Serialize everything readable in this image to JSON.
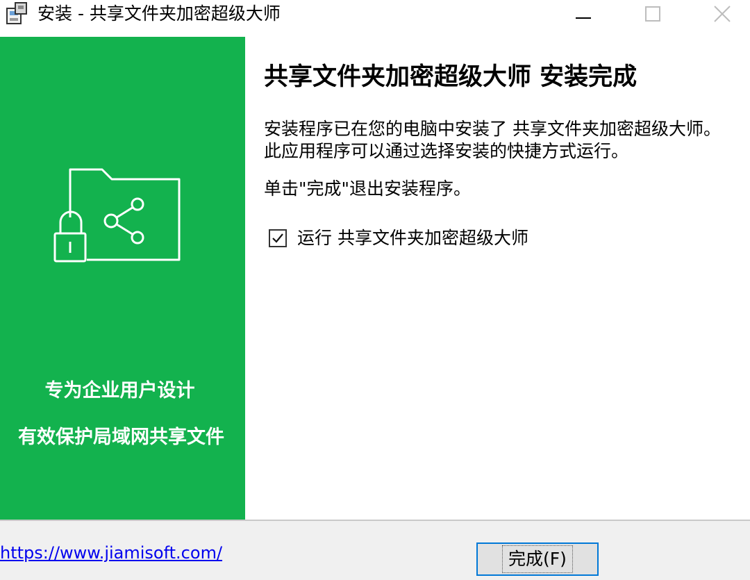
{
  "window": {
    "title": "安装 - 共享文件夹加密超级大师",
    "controls": {
      "minimize": "minimize-icon",
      "maximize": "maximize-icon",
      "close": "close-icon"
    }
  },
  "side_panel": {
    "background": "#13b24e",
    "icon": "folder-lock-share-icon",
    "line1": "专为企业用户设计",
    "line2": "有效保护局域网共享文件"
  },
  "content": {
    "title": "共享文件夹加密超级大师 安装完成",
    "description": "安装程序已在您的电脑中安装了 共享文件夹加密超级大师。此应用程序可以通过选择安装的快捷方式运行。",
    "hint": "单击\"完成\"退出安装程序。",
    "run_checkbox": {
      "label": "运行 共享文件夹加密超级大师",
      "checked": true
    }
  },
  "footer": {
    "link": "https://www.jiamisoft.com/",
    "finish_button": "完成(F)"
  }
}
